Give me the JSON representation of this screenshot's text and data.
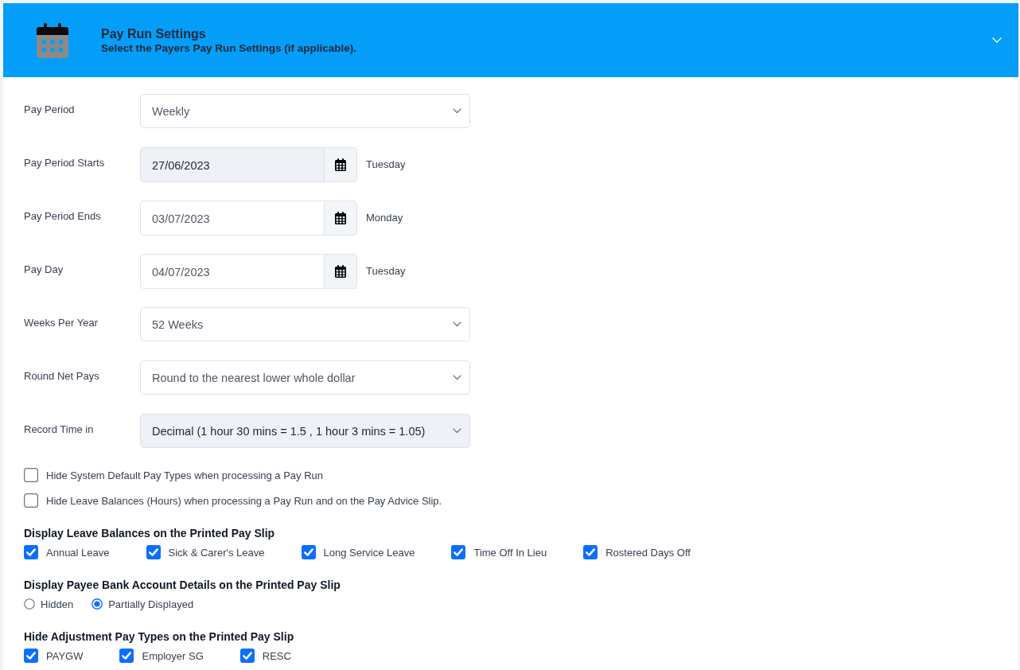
{
  "header": {
    "title": "Pay Run Settings",
    "subtitle": "Select the Payers Pay Run Settings (if applicable)."
  },
  "fields": [
    {
      "kind": "select",
      "label": "Pay Period",
      "value": "Weekly",
      "disabled": false
    },
    {
      "kind": "date",
      "label": "Pay Period Starts",
      "value": "27/06/2023",
      "disabled": true,
      "day": "Tuesday"
    },
    {
      "kind": "date",
      "label": "Pay Period Ends",
      "value": "03/07/2023",
      "disabled": false,
      "day": "Monday"
    },
    {
      "kind": "date",
      "label": "Pay Day",
      "value": "04/07/2023",
      "disabled": false,
      "day": "Tuesday"
    },
    {
      "kind": "select",
      "label": "Weeks Per Year",
      "value": "52 Weeks",
      "disabled": false
    },
    {
      "kind": "select",
      "label": "Round Net Pays",
      "value": "Round to the nearest lower whole dollar",
      "disabled": false
    },
    {
      "kind": "select",
      "label": "Record Time in",
      "value": "Decimal (1 hour 30 mins = 1.5 , 1 hour 3 mins = 1.05)",
      "disabled": true
    }
  ],
  "options": [
    {
      "label": "Hide System Default Pay Types when processing a Pay Run",
      "checked": false
    },
    {
      "label": "Hide Leave Balances (Hours) when processing a Pay Run and on the Pay Advice Slip.",
      "checked": false
    }
  ],
  "groups": [
    {
      "kind": "checkboxes",
      "title": "Display Leave Balances on the Printed Pay Slip",
      "items": [
        {
          "label": "Annual Leave",
          "checked": true
        },
        {
          "label": "Sick & Carer's Leave",
          "checked": true
        },
        {
          "label": "Long Service Leave",
          "checked": true
        },
        {
          "label": "Time Off In Lieu",
          "checked": true
        },
        {
          "label": "Rostered Days Off",
          "checked": true
        }
      ]
    },
    {
      "kind": "radios",
      "title": "Display Payee Bank Account Details on the Printed Pay Slip",
      "items": [
        {
          "label": "Hidden",
          "selected": false
        },
        {
          "label": "Partially Displayed",
          "selected": true
        }
      ]
    },
    {
      "kind": "checkboxes",
      "title": "Hide Adjustment Pay Types on the Printed Pay Slip",
      "items": [
        {
          "label": "PAYGW",
          "checked": true
        },
        {
          "label": "Employer SG",
          "checked": true
        },
        {
          "label": "RESC",
          "checked": true
        }
      ]
    }
  ]
}
